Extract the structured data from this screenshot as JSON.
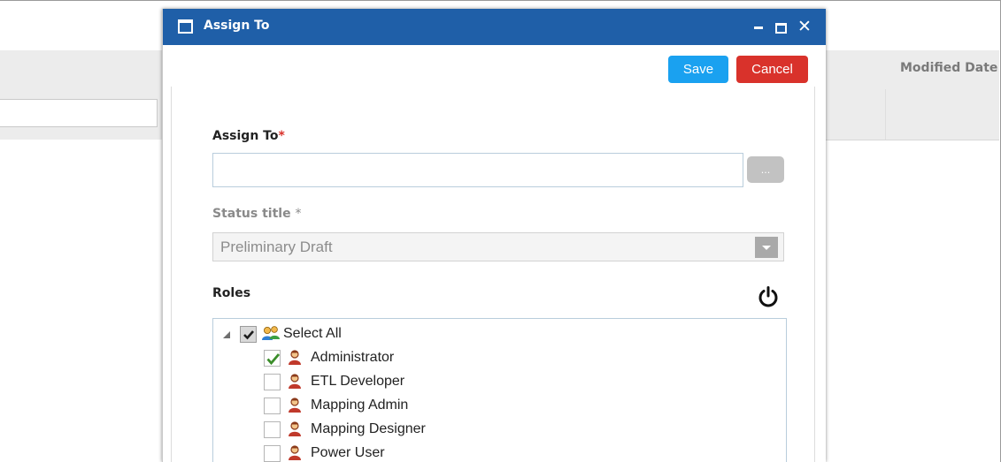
{
  "background": {
    "column_header": "Modified Date"
  },
  "dialog": {
    "title": "Assign To",
    "buttons": {
      "save": "Save",
      "cancel": "Cancel"
    },
    "assign_to": {
      "label": "Assign To",
      "required_mark": "*",
      "value": "",
      "browse_label": "..."
    },
    "status": {
      "label": "Status title",
      "required_mark": "*",
      "selected": "Preliminary Draft"
    },
    "roles": {
      "label": "Roles",
      "select_all": {
        "label": "Select All",
        "state": "partial"
      },
      "items": [
        {
          "label": "Administrator",
          "checked": true
        },
        {
          "label": "ETL Developer",
          "checked": false
        },
        {
          "label": "Mapping Admin",
          "checked": false
        },
        {
          "label": "Mapping Designer",
          "checked": false
        },
        {
          "label": "Power User",
          "checked": false
        }
      ]
    }
  },
  "colors": {
    "titlebar": "#1f5fa8",
    "save": "#1aa1f0",
    "cancel": "#d9322b",
    "check": "#3b8d2a"
  },
  "icons": [
    "window-icon",
    "minimize-icon",
    "maximize-icon",
    "close-icon",
    "power-icon",
    "group-icon",
    "user-icon",
    "checkmark-icon",
    "expand-arrow-icon"
  ]
}
